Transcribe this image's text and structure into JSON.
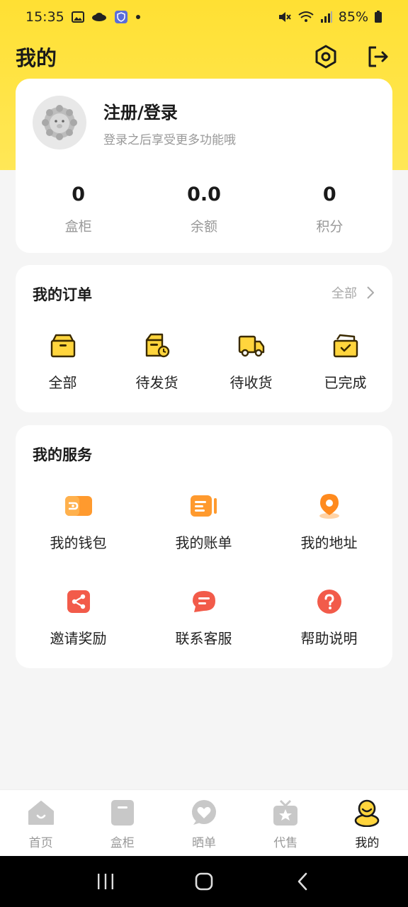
{
  "status": {
    "time": "15:35",
    "battery": "85%",
    "left_icons": [
      "gallery-icon",
      "cloud-icon",
      "shield-icon",
      "dot-icon"
    ],
    "right_icons": [
      "mute-icon",
      "wifi-icon",
      "signal-icon",
      "battery-icon"
    ]
  },
  "header": {
    "title": "我的",
    "icons": [
      "settings-icon",
      "logout-icon"
    ]
  },
  "profile": {
    "login_title": "注册/登录",
    "login_subtitle": "登录之后享受更多功能哦",
    "stats": [
      {
        "value": "0",
        "label": "盒柜"
      },
      {
        "value": "0.0",
        "label": "余额"
      },
      {
        "value": "0",
        "label": "积分"
      }
    ]
  },
  "orders": {
    "title": "我的订单",
    "more_label": "全部",
    "items": [
      {
        "label": "全部",
        "icon": "box-icon"
      },
      {
        "label": "待发货",
        "icon": "pending-ship-icon"
      },
      {
        "label": "待收货",
        "icon": "truck-icon"
      },
      {
        "label": "已完成",
        "icon": "completed-icon"
      }
    ]
  },
  "services": {
    "title": "我的服务",
    "items": [
      {
        "label": "我的钱包",
        "icon": "wallet-icon"
      },
      {
        "label": "我的账单",
        "icon": "bill-icon"
      },
      {
        "label": "我的地址",
        "icon": "location-icon"
      },
      {
        "label": "邀请奖励",
        "icon": "share-icon"
      },
      {
        "label": "联系客服",
        "icon": "chat-icon"
      },
      {
        "label": "帮助说明",
        "icon": "help-icon"
      }
    ]
  },
  "tabs": [
    {
      "label": "首页",
      "icon": "home-icon",
      "active": false
    },
    {
      "label": "盒柜",
      "icon": "cabinet-icon",
      "active": false
    },
    {
      "label": "晒单",
      "icon": "heart-bubble-icon",
      "active": false
    },
    {
      "label": "代售",
      "icon": "gift-icon",
      "active": false
    },
    {
      "label": "我的",
      "icon": "user-icon",
      "active": true
    }
  ],
  "colors": {
    "brand_yellow": "#FFE033",
    "icon_yellow": "#FFD53D",
    "icon_orange": "#FF9A2E",
    "icon_red": "#F25B4A",
    "tab_inactive": "#C8C8C8"
  }
}
